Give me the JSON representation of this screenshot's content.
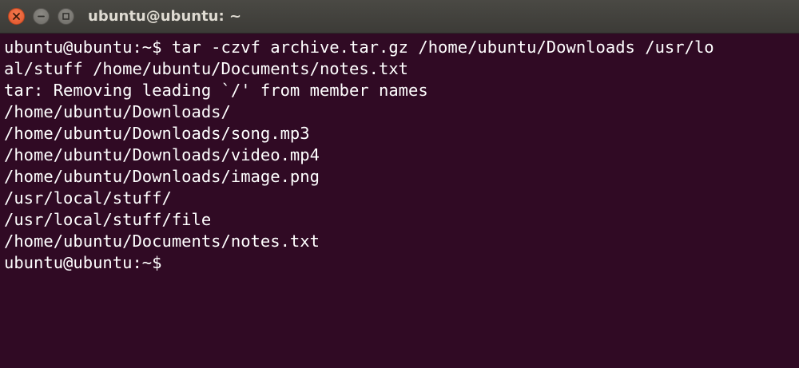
{
  "window": {
    "title": "ubuntu@ubuntu: ~",
    "buttons": {
      "close_icon": "close-icon",
      "minimize_icon": "minimize-icon",
      "maximize_icon": "maximize-icon"
    },
    "colors": {
      "terminal_background": "#300a24",
      "titlebar": "#3c3b37",
      "close_button": "#e95420",
      "text": "#ffffff"
    }
  },
  "terminal": {
    "lines": [
      "ubuntu@ubuntu:~$ tar -czvf archive.tar.gz /home/ubuntu/Downloads /usr/lo",
      "al/stuff /home/ubuntu/Documents/notes.txt",
      "tar: Removing leading `/' from member names",
      "/home/ubuntu/Downloads/",
      "/home/ubuntu/Downloads/song.mp3",
      "/home/ubuntu/Downloads/video.mp4",
      "/home/ubuntu/Downloads/image.png",
      "/usr/local/stuff/",
      "/usr/local/stuff/file",
      "/home/ubuntu/Documents/notes.txt",
      "ubuntu@ubuntu:~$"
    ]
  }
}
